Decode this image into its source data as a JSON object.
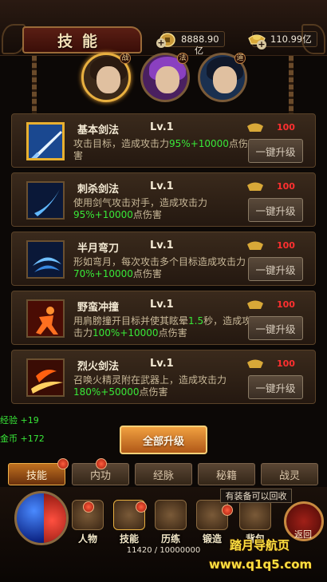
{
  "header": {
    "title": "技能",
    "gold_value": "8888.90",
    "gold_unit": "亿",
    "ingot_value": "110.99亿"
  },
  "characters": [
    {
      "class_label": "战",
      "active": true
    },
    {
      "class_label": "法",
      "active": false
    },
    {
      "class_label": "道",
      "active": false
    }
  ],
  "skills": [
    {
      "name": "基本剑法",
      "level": "Lv.1",
      "desc_parts": [
        {
          "t": "攻击目标，造成攻击力",
          "h": false
        },
        {
          "t": "95%+10000",
          "h": true
        },
        {
          "t": "点伤害",
          "h": false
        }
      ],
      "cost": "100",
      "button": "一键升级",
      "icon": "sword-strike-icon"
    },
    {
      "name": "刺杀剑法",
      "level": "Lv.1",
      "desc_parts": [
        {
          "t": "使用剑气攻击对手，造成攻击力",
          "h": false
        },
        {
          "t": "95%+10000",
          "h": true
        },
        {
          "t": "点伤害",
          "h": false
        }
      ],
      "cost": "100",
      "button": "一键升级",
      "icon": "sword-slash-icon"
    },
    {
      "name": "半月弯刀",
      "level": "Lv.1",
      "desc_parts": [
        {
          "t": "形如弯月，每次攻击多个目标造成攻击力",
          "h": false
        },
        {
          "t": "70%+10000",
          "h": true
        },
        {
          "t": "点伤害",
          "h": false
        }
      ],
      "cost": "100",
      "button": "一键升级",
      "icon": "crescent-blade-icon"
    },
    {
      "name": "野蛮冲撞",
      "level": "Lv.1",
      "desc_parts": [
        {
          "t": "用肩膀撞开目标并使其眩晕",
          "h": false
        },
        {
          "t": "1.5",
          "h": true
        },
        {
          "t": "秒，造成攻击力",
          "h": false
        },
        {
          "t": "100%+10000",
          "h": true
        },
        {
          "t": "点伤害",
          "h": false
        }
      ],
      "cost": "100",
      "button": "一键升级",
      "icon": "charge-icon"
    },
    {
      "name": "烈火剑法",
      "level": "Lv.1",
      "desc_parts": [
        {
          "t": "召唤火精灵附在武器上，造成攻击力",
          "h": false
        },
        {
          "t": "180%+50000",
          "h": true
        },
        {
          "t": "点伤害",
          "h": false
        }
      ],
      "cost": "100",
      "button": "一键升级",
      "icon": "fire-sword-icon"
    }
  ],
  "gains": {
    "exp_label": "经验",
    "exp_value": "+19",
    "gold_label": "金币",
    "gold_value": "+172"
  },
  "upgrade_all": "全部升级",
  "tabs": [
    {
      "label": "技能",
      "active": true,
      "dot": true
    },
    {
      "label": "内功",
      "active": false,
      "dot": true
    },
    {
      "label": "经脉",
      "active": false,
      "dot": false
    },
    {
      "label": "秘籍",
      "active": false,
      "dot": false
    },
    {
      "label": "战灵",
      "active": false,
      "dot": false
    }
  ],
  "nav": [
    {
      "label": "人物",
      "dot": true
    },
    {
      "label": "技能",
      "dot": true
    },
    {
      "label": "历练",
      "dot": false
    },
    {
      "label": "锻造",
      "dot": true
    },
    {
      "label": "背包",
      "dot": false
    }
  ],
  "hint": "有装备可以回收",
  "return_label": "返回",
  "exp_bar": "11420 / 10000000",
  "watermark": {
    "line1": "踏月导航页",
    "line2": "www.q1q5.com"
  },
  "colors": {
    "highlight": "#38e838",
    "cost": "#ff3030",
    "accent": "#e8b030"
  }
}
